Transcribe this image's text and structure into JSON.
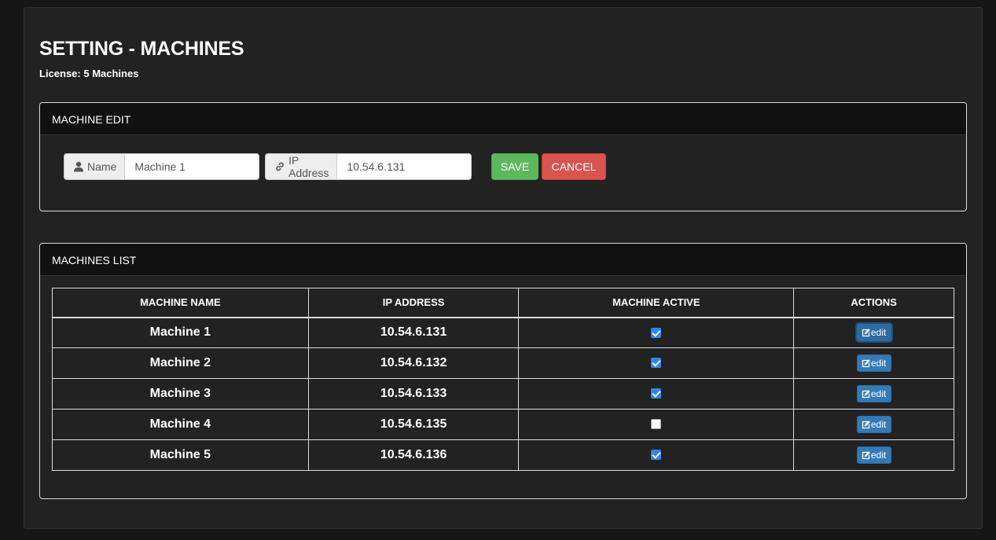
{
  "page": {
    "title": "SETTING - MACHINES",
    "license": "License: 5 Machines"
  },
  "edit_panel": {
    "heading": "MACHINE EDIT",
    "name_label": "Name",
    "name_value": "Machine 1",
    "ip_label": "IP Address",
    "ip_value": "10.54.6.131",
    "save_label": "SAVE",
    "cancel_label": "CANCEL",
    "icons": {
      "name": "user-icon",
      "ip": "link-icon"
    }
  },
  "list_panel": {
    "heading": "MACHINES LIST",
    "columns": [
      "MACHINE NAME",
      "IP ADDRESS",
      "MACHINE ACTIVE",
      "ACTIONS"
    ],
    "edit_label": "edit",
    "rows": [
      {
        "name": "Machine 1",
        "ip": "10.54.6.131",
        "active": true
      },
      {
        "name": "Machine 2",
        "ip": "10.54.6.132",
        "active": true
      },
      {
        "name": "Machine 3",
        "ip": "10.54.6.133",
        "active": true
      },
      {
        "name": "Machine 4",
        "ip": "10.54.6.135",
        "active": false
      },
      {
        "name": "Machine 5",
        "ip": "10.54.6.136",
        "active": true
      }
    ]
  },
  "colors": {
    "background": "#222222",
    "save": "#5cb85c",
    "cancel": "#d9534f",
    "edit": "#337ab7",
    "checkbox": "#2d86f5"
  }
}
